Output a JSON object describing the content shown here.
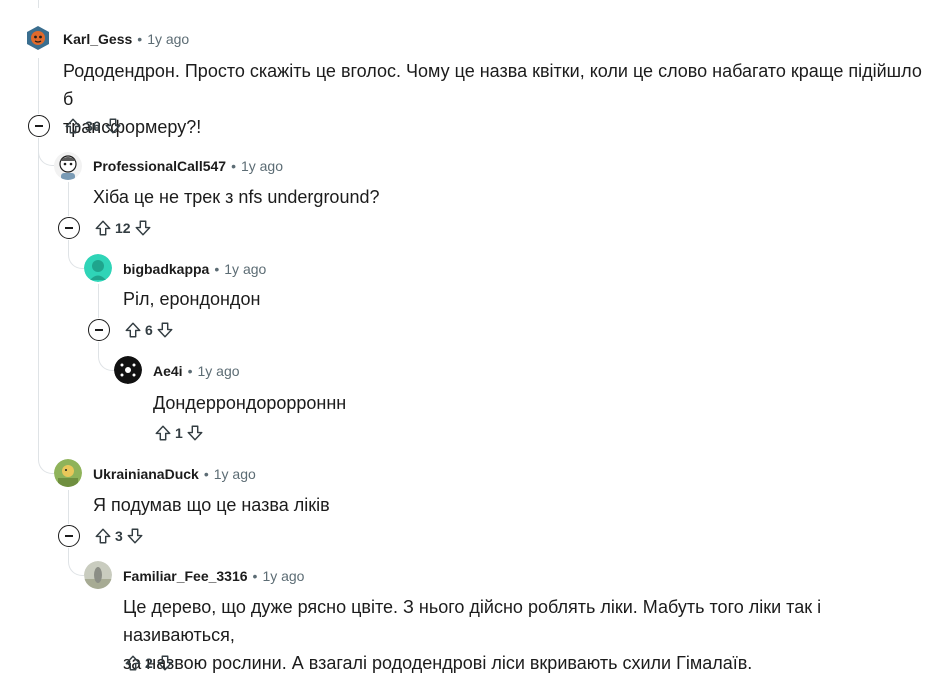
{
  "comments": [
    {
      "author": "Karl_Gess",
      "time": "1y ago",
      "body_lines": [
        "Рододендрон. Просто скажіть це вголос. Чому це назва квітки, коли це слово набагато краще підійшло б",
        "трансформеру?!"
      ],
      "score": "36"
    },
    {
      "author": "ProfessionalCall547",
      "time": "1y ago",
      "body_lines": [
        "Хіба це не трек з nfs underground?"
      ],
      "score": "12"
    },
    {
      "author": "bigbadkappa",
      "time": "1y ago",
      "body_lines": [
        "Ріл, ерондондон"
      ],
      "score": "6"
    },
    {
      "author": "Ae4i",
      "time": "1y ago",
      "body_lines": [
        "Дондеррондорорроннн"
      ],
      "score": "1"
    },
    {
      "author": "UkrainianaDuck",
      "time": "1y ago",
      "body_lines": [
        "Я подумав що це назва ліків"
      ],
      "score": "3"
    },
    {
      "author": "Familiar_Fee_3316",
      "time": "1y ago",
      "body_lines": [
        "Це дерево, що дуже рясно цвіте. З нього дійсно роблять ліки. Мабуть того ліки так і називаються,",
        "за назвою рослини. А взагалі рододендрові ліси вкривають схили Гімалаїв."
      ],
      "score": "2"
    }
  ],
  "separator": "•",
  "icons": {
    "upvote": "upvote-arrow-icon",
    "downvote": "downvote-arrow-icon",
    "collapse": "minus-circle-icon"
  }
}
